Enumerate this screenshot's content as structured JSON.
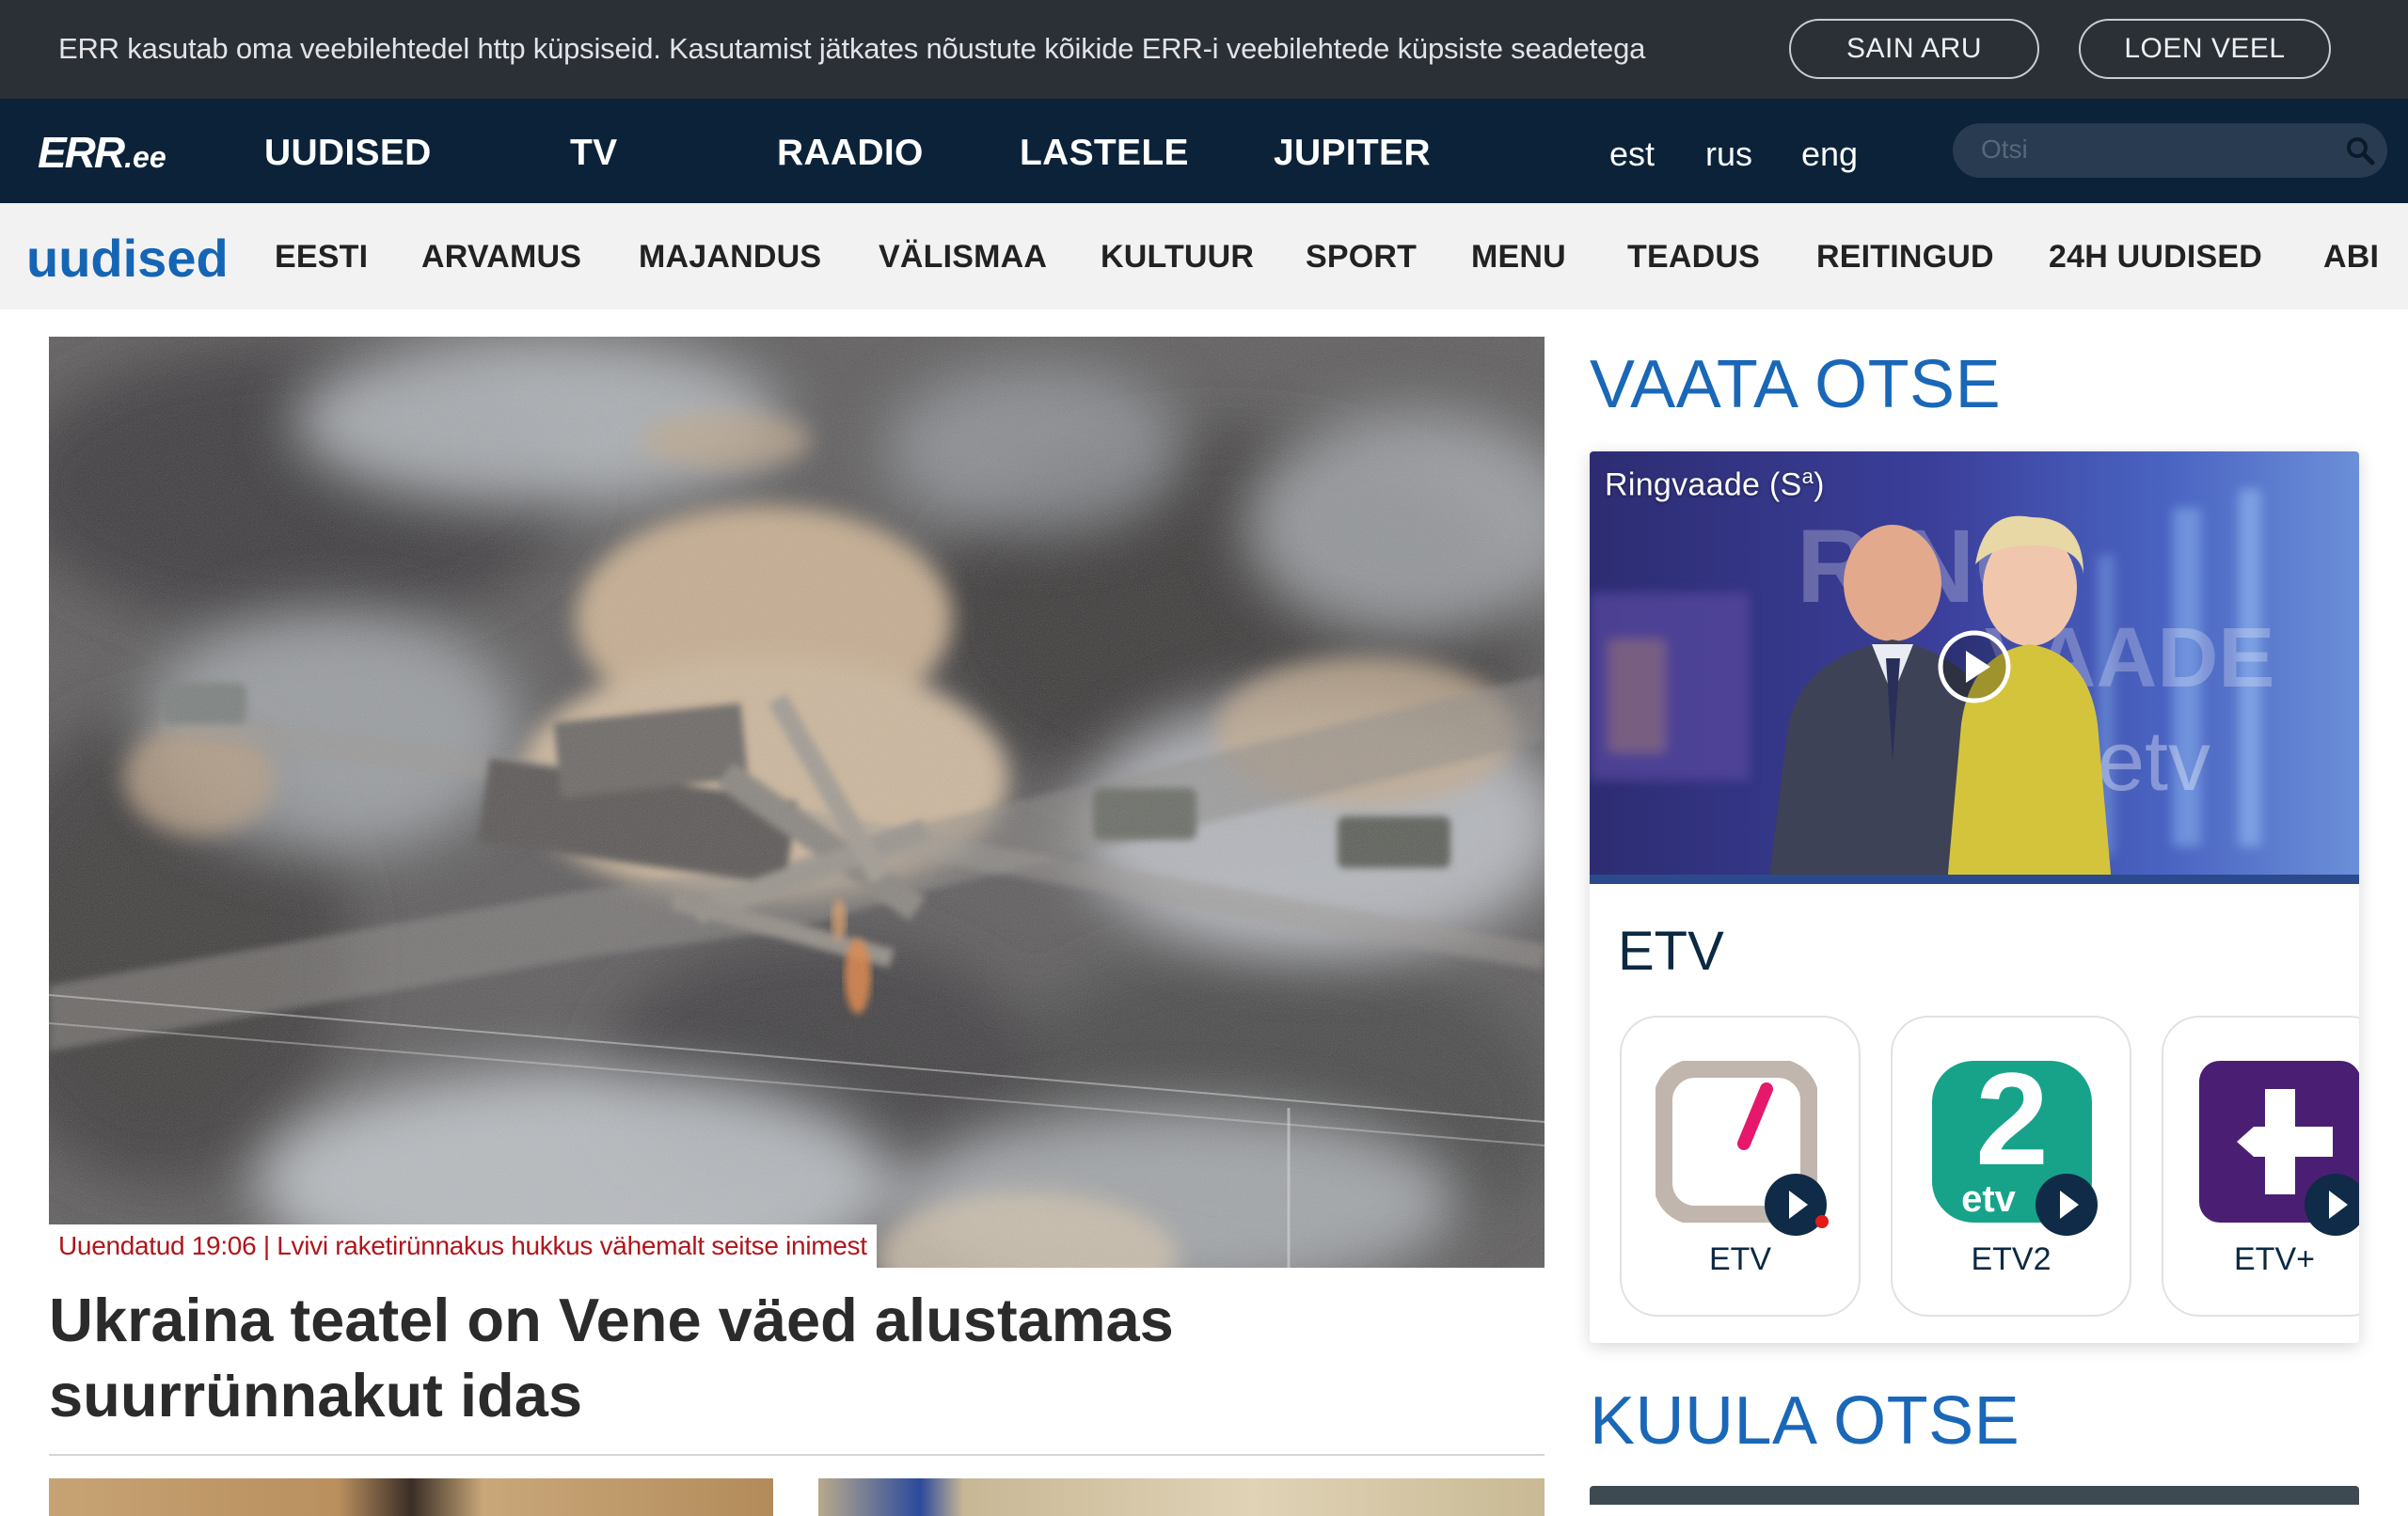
{
  "cookie": {
    "text": "ERR kasutab oma veebilehtedel http küpsiseid. Kasutamist jätkates nõustute kõikide ERR-i veebilehtede küpsiste seadetega",
    "agree_label": "SAIN ARU",
    "more_label": "LOEN VEEL"
  },
  "header": {
    "logo_err": "ERR",
    "logo_ee": ".ee",
    "nav": [
      "UUDISED",
      "TV",
      "RAADIO",
      "LASTELE",
      "JUPITER"
    ],
    "langs": [
      "est",
      "rus",
      "eng"
    ],
    "search_placeholder": "Otsi"
  },
  "subnav": {
    "logo": "uudised",
    "items": [
      "EESTI",
      "ARVAMUS",
      "MAJANDUS",
      "VÄLISMAA",
      "KULTUUR",
      "SPORT",
      "MENU",
      "TEADUS",
      "REITINGUD",
      "24H UUDISED",
      "ABI"
    ]
  },
  "hero": {
    "caption": "Uuendatud 19:06 | Lvivi raketirünnakus hukkus vähemalt seitse inimest",
    "title": "Ukraina teatel on Vene väed alustamas suurrünnakut idas"
  },
  "live": {
    "watch_title": "VAATA OTSE",
    "video_label": "Ringvaade (S",
    "video_label_sup": "a",
    "video_label_end": ")",
    "channel_name": "ETV",
    "channels": [
      {
        "label": "ETV",
        "icon": "etv-logo-icon"
      },
      {
        "label": "ETV2",
        "icon": "etv2-logo-icon"
      },
      {
        "label": "ETV+",
        "icon": "etv-plus-logo-icon"
      }
    ],
    "listen_title": "KUULA OTSE"
  },
  "colors": {
    "cookie_bg": "#2b2f36",
    "nav_bg": "#0b2239",
    "accent_blue": "#1a67b8",
    "caption_red": "#b0151c",
    "etv_pink": "#e5186c",
    "etv2_green": "#17a38a",
    "etvplus_purple": "#4a1f73"
  }
}
